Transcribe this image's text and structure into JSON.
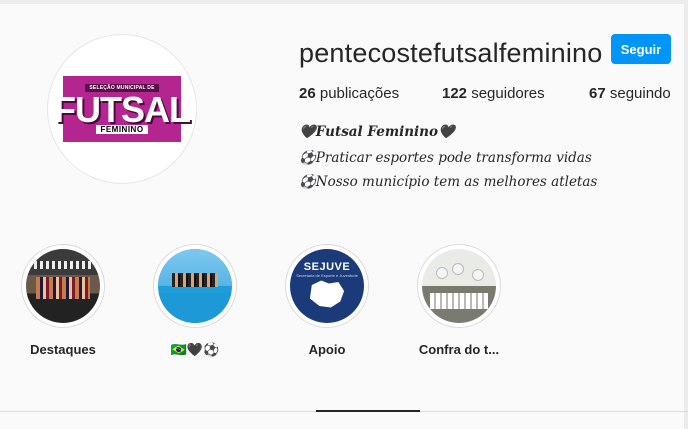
{
  "profile": {
    "logo": {
      "top_text": "SELEÇÃO MUNICIPAL DE",
      "main_text": "FUTSAL",
      "sub_text": "FEMININO"
    },
    "username": "pentecostefutsalfeminino",
    "follow_label": "Seguir",
    "stats": {
      "posts_count": "26",
      "posts_label": "publicações",
      "followers_count": "122",
      "followers_label": "seguidores",
      "following_count": "67",
      "following_label": "seguindo"
    },
    "bio": [
      "🖤Futsal Feminino🖤",
      "⚽Praticar esportes pode transforma vidas",
      "⚽Nosso município tem as melhores atletas"
    ]
  },
  "highlights": [
    {
      "label": "Destaques"
    },
    {
      "label": "🇧🇷🖤⚽"
    },
    {
      "label": "Apoio",
      "image_text": "SEJUVE",
      "image_subtext": "Secretaria de Esporte e Juventude"
    },
    {
      "label": "Confra do t..."
    }
  ],
  "colors": {
    "follow_button": "#0095f6",
    "logo_background": "#b4258f",
    "sejuve_background": "#1b3a7a"
  }
}
